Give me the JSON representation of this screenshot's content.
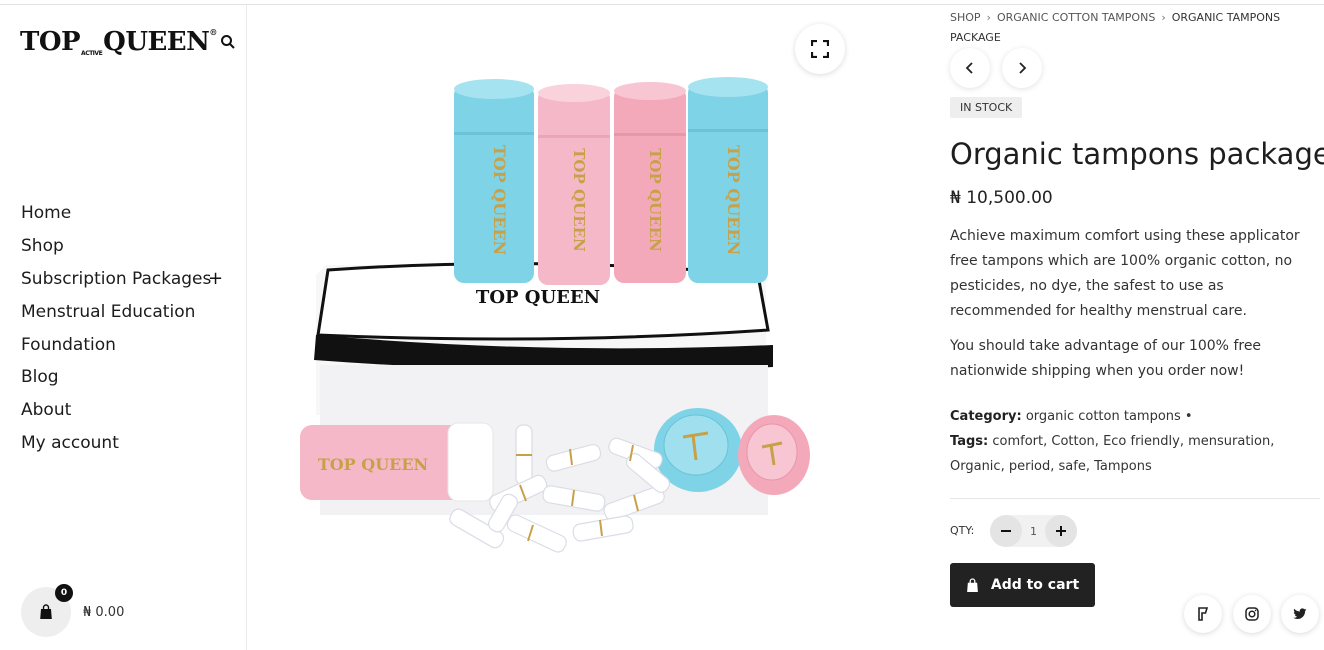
{
  "brand": {
    "logo_left": "TOP",
    "logo_small": "ACTIVE",
    "logo_right": "QUEEN",
    "logo_reg": "®"
  },
  "nav": {
    "items": [
      {
        "label": "Home"
      },
      {
        "label": "Shop"
      },
      {
        "label": "Subscription Packages",
        "expand": "+"
      },
      {
        "label": "Menstrual Education"
      },
      {
        "label": "Foundation"
      },
      {
        "label": "Blog"
      },
      {
        "label": "About"
      },
      {
        "label": "My account"
      }
    ]
  },
  "cart": {
    "count": "0",
    "total": "₦ 0.00"
  },
  "breadcrumb": {
    "items": [
      "SHOP",
      "ORGANIC COTTON TAMPONS",
      "ORGANIC TAMPONS PACKAGE"
    ],
    "separator": "›"
  },
  "product": {
    "stock": "IN STOCK",
    "title": "Organic tampons package",
    "price": "₦ 10,500.00",
    "description": [
      "Achieve maximum comfort using these applicator free tampons which are 100% organic cotton, no pesticides, no dye, the safest to use as recommended for healthy menstrual care.",
      "You should take advantage of our 100% free nationwide shipping when you order now!"
    ],
    "category_label": "Category:",
    "category": "organic cotton tampons",
    "tags_label": "Tags:",
    "tags": [
      "comfort",
      "Cotton",
      "Eco friendly",
      "mensuration",
      "Organic",
      "period",
      "safe",
      "Tampons"
    ],
    "qty_label": "QTY:",
    "qty_value": "1",
    "add_to_cart": "Add to cart"
  },
  "image_text": {
    "tube_brand": "TOP QUEEN",
    "box_brand": "TOP QUEEN"
  },
  "colors": {
    "blue_tube": "#7fd3e6",
    "pink_tube": "#f5b3c4",
    "dark_button": "#222222"
  },
  "icons": {
    "zoom": "expand-icon",
    "prev": "chevron-left-icon",
    "next": "chevron-right-icon",
    "cart": "shopping-bag-icon",
    "social": [
      "foursquare-icon",
      "instagram-icon",
      "twitter-icon"
    ]
  }
}
